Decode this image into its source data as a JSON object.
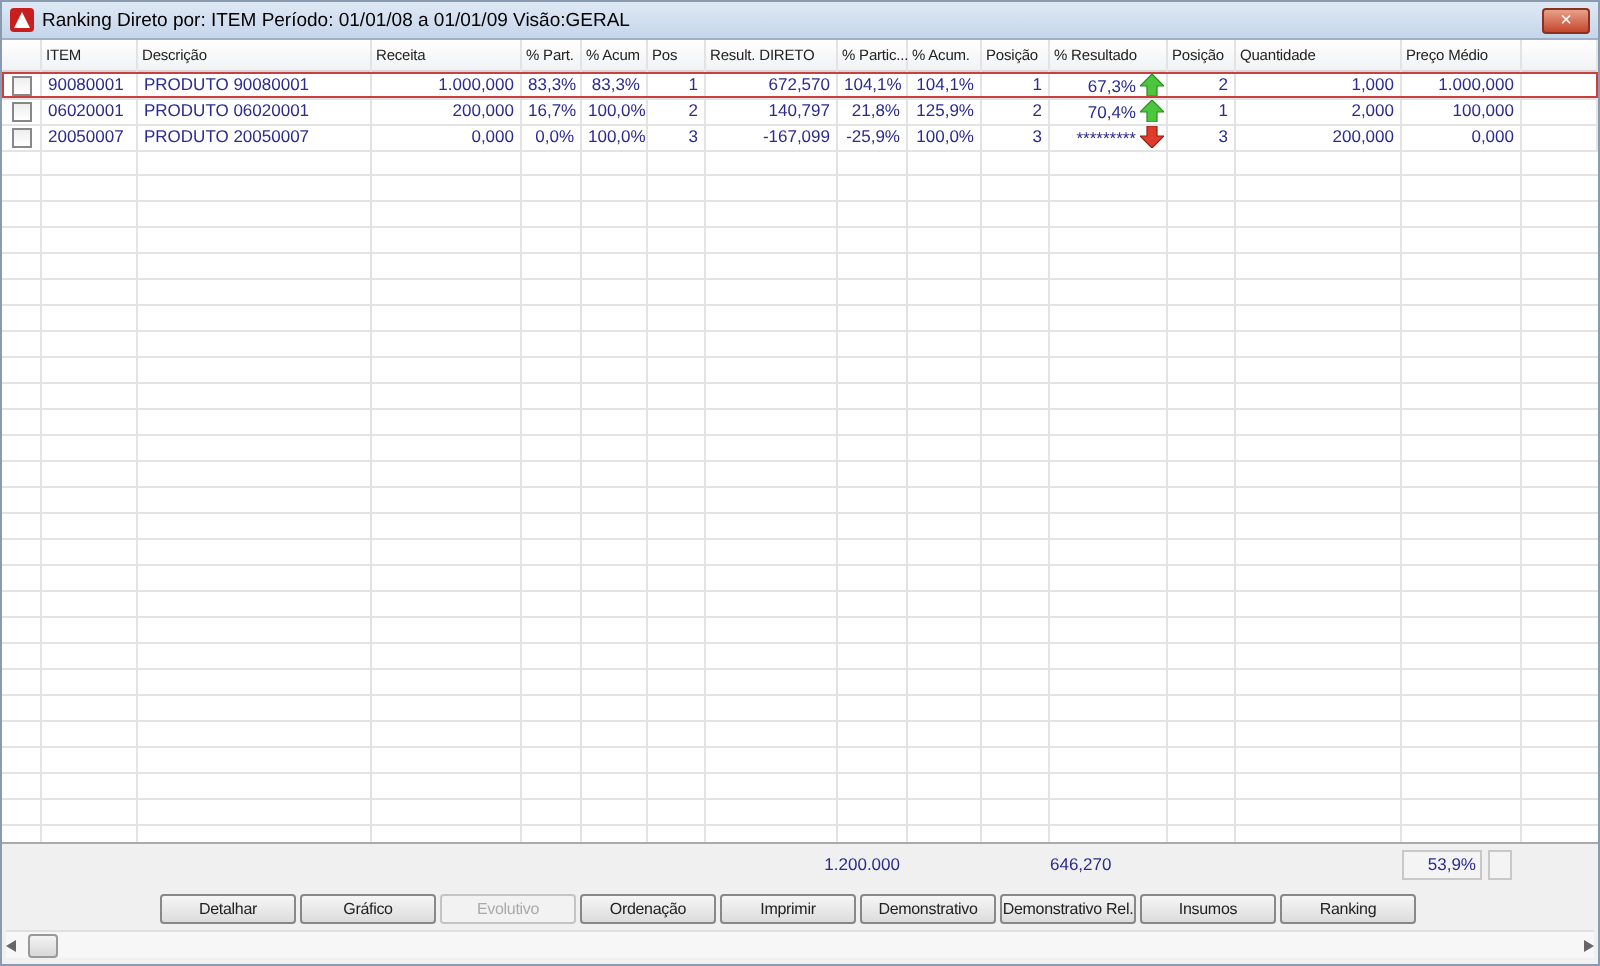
{
  "window": {
    "title": "Ranking Direto por: ITEM Período: 01/01/08 a 01/01/09 Visão:GERAL",
    "close": "×"
  },
  "table": {
    "columns": [
      "ITEM",
      "Descrição",
      "Receita",
      "% Part.",
      "% Acum",
      "Pos",
      "Result. DIRETO",
      "% Partic...",
      "% Acum.",
      "Posição",
      "% Resultado",
      "Posição",
      "Quantidade",
      "Preço Médio"
    ],
    "rows": [
      {
        "checked": false,
        "selected": true,
        "cells": [
          "90080001",
          "PRODUTO 90080001",
          "1.000,000",
          "83,3%",
          "83,3%",
          "1",
          "672,570",
          "104,1%",
          "104,1%",
          "1",
          "67,3%",
          "2",
          "1,000",
          "1.000,000"
        ],
        "trend_up": true
      },
      {
        "checked": false,
        "selected": false,
        "cells": [
          "06020001",
          "PRODUTO 06020001",
          "200,000",
          "16,7%",
          "100,0%",
          "2",
          "140,797",
          "21,8%",
          "125,9%",
          "2",
          "70,4%",
          "1",
          "2,000",
          "100,000"
        ],
        "trend_up": true
      },
      {
        "checked": false,
        "selected": false,
        "cells": [
          "20050007",
          "PRODUTO 20050007",
          "0,000",
          "0,0%",
          "100,0%",
          "3",
          "-167,099",
          "-25,9%",
          "100,0%",
          "3",
          "*********",
          "3",
          "200,000",
          "0,000"
        ],
        "trend_up": false
      }
    ]
  },
  "totals": {
    "result": "1.200.000",
    "result_2": "646,270",
    "percent": "53,9%"
  },
  "buttons": [
    {
      "label": "Detalhar",
      "disabled": false
    },
    {
      "label": "Gráfico",
      "disabled": false
    },
    {
      "label": "Evolutivo",
      "disabled": true
    },
    {
      "label": "Ordenação",
      "disabled": false
    },
    {
      "label": "Imprimir",
      "disabled": false
    },
    {
      "label": "Demonstrativo",
      "disabled": false
    },
    {
      "label": "Demonstrativo Rel.",
      "disabled": false
    },
    {
      "label": "Insumos",
      "disabled": false
    },
    {
      "label": "Ranking",
      "disabled": false
    }
  ]
}
